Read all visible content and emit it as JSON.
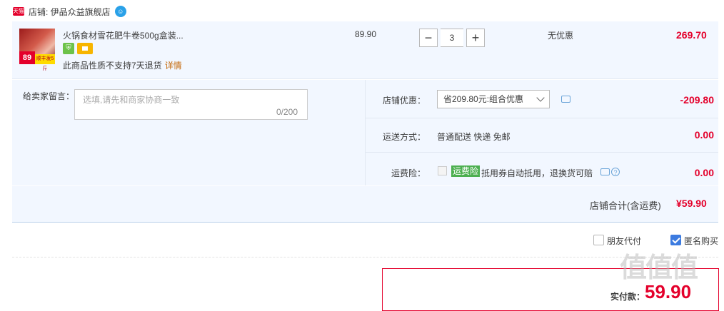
{
  "shop": {
    "badge": "天猫",
    "label": "店铺: 伊品众益旗舰店",
    "chat_icon": "wangwang-icon"
  },
  "item": {
    "title": "火锅食材雪花肥牛卷500g盒装...",
    "thumb_badge": "89",
    "thumb_badge2": "顺丰发5斤",
    "notice": "此商品性质不支持7天退货",
    "notice_link": "详情",
    "price": "89.90",
    "qty_minus": "−",
    "qty_value": "3",
    "qty_plus": "+",
    "discount": "无优惠",
    "subtotal": "269.70"
  },
  "message": {
    "label": "给卖家留言：",
    "placeholder": "选填,请先和商家协商一致",
    "count": "0/200"
  },
  "options": {
    "shop_discount_label": "店铺优惠：",
    "shop_discount_value": "省209.80元:组合优惠",
    "shop_discount_amount": "-209.80",
    "delivery_label": "运送方式：",
    "delivery_value": "普通配送 快递 免邮",
    "delivery_amount": "0.00",
    "insurance_label": "运费险：",
    "insurance_tag": "运费险",
    "insurance_text": "抵用券自动抵用，退换货可赔",
    "insurance_amount": "0.00",
    "help_glyph": "?"
  },
  "total": {
    "label": "店铺合计(含运费)",
    "amount": "¥59.90"
  },
  "checkout": {
    "friend_pay": "朋友代付",
    "anonymous": "匿名购买",
    "anonymous_checked": true,
    "pay_label": "实付款：",
    "pay_amount": "59.90"
  },
  "colors": {
    "accent": "#e4002b",
    "panel": "#f2f7ff",
    "check": "#3c7be0"
  }
}
